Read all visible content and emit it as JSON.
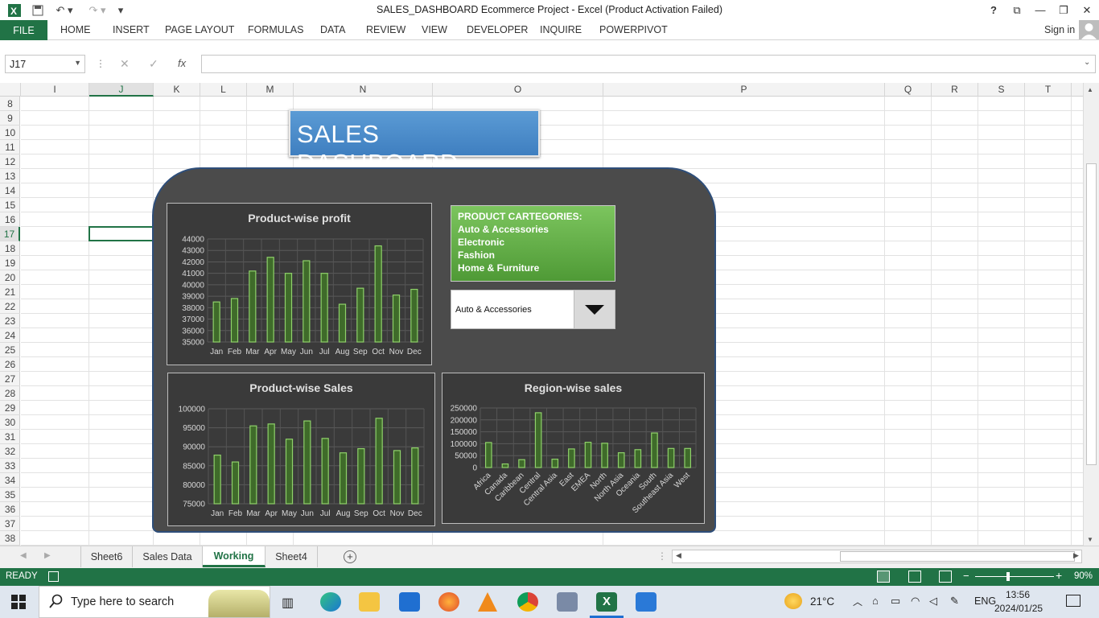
{
  "window": {
    "title": "SALES_DASHBOARD Ecommerce Project - Excel (Product Activation Failed)",
    "help": "?",
    "sign_in": "Sign in"
  },
  "ribbon": {
    "file": "FILE",
    "tabs": [
      "HOME",
      "INSERT",
      "PAGE LAYOUT",
      "FORMULAS",
      "DATA",
      "REVIEW",
      "VIEW",
      "DEVELOPER",
      "INQUIRE",
      "POWERPIVOT"
    ]
  },
  "formula_bar": {
    "name_box": "J17",
    "fx": "fx",
    "formula": ""
  },
  "grid": {
    "columns": [
      "I",
      "J",
      "K",
      "L",
      "M",
      "N",
      "O",
      "P",
      "Q",
      "R",
      "S",
      "T"
    ],
    "rows": [
      "8",
      "9",
      "10",
      "11",
      "12",
      "13",
      "14",
      "15",
      "16",
      "17",
      "18",
      "19",
      "20",
      "21",
      "22",
      "23",
      "24",
      "25",
      "26",
      "27",
      "28",
      "29",
      "30",
      "31",
      "32",
      "33",
      "34",
      "35",
      "36",
      "37",
      "38"
    ],
    "selected_cell": "J17"
  },
  "dashboard": {
    "banner": "SALES  DASHBOARD",
    "categories_title": "PRODUCT CARTEGORIES:",
    "categories": [
      "Auto & Accessories",
      "Electronic",
      "Fashion",
      "Home & Furniture"
    ],
    "dropdown_value": "Auto & Accessories",
    "accent_color": "#8fd16a"
  },
  "chart_data": [
    {
      "type": "bar",
      "title": "Product-wise profit",
      "categories": [
        "Jan",
        "Feb",
        "Mar",
        "Apr",
        "May",
        "Jun",
        "Jul",
        "Aug",
        "Sep",
        "Oct",
        "Nov",
        "Dec"
      ],
      "values": [
        38500,
        38800,
        41200,
        42400,
        41000,
        42100,
        41000,
        38300,
        39700,
        43400,
        39100,
        39600
      ],
      "yticks": [
        "44000",
        "43000",
        "42000",
        "41000",
        "40000",
        "39000",
        "38000",
        "37000",
        "36000",
        "35000"
      ],
      "ylim": [
        35000,
        44000
      ]
    },
    {
      "type": "bar",
      "title": "Product-wise Sales",
      "categories": [
        "Jan",
        "Feb",
        "Mar",
        "Apr",
        "May",
        "Jun",
        "Jul",
        "Aug",
        "Sep",
        "Oct",
        "Nov",
        "Dec"
      ],
      "values": [
        87800,
        86000,
        95500,
        96000,
        92000,
        96800,
        92200,
        88400,
        89500,
        97500,
        89000,
        89700
      ],
      "yticks": [
        "100000",
        "95000",
        "90000",
        "85000",
        "80000",
        "75000"
      ],
      "ylim": [
        75000,
        100000
      ]
    },
    {
      "type": "bar",
      "title": "Region-wise sales",
      "categories": [
        "Africa",
        "Canada",
        "Caribbean",
        "Central",
        "Central Asia",
        "East",
        "EMEA",
        "North",
        "North Asia",
        "Oceania",
        "South",
        "Southeast Asia",
        "West"
      ],
      "values": [
        105000,
        15000,
        33000,
        230000,
        35000,
        78000,
        106000,
        102000,
        62000,
        75000,
        145000,
        80000,
        80000
      ],
      "yticks": [
        "250000",
        "200000",
        "150000",
        "100000",
        "50000",
        "0"
      ],
      "ylim": [
        0,
        250000
      ]
    }
  ],
  "sheets": {
    "tabs": [
      "Sheet6",
      "Sales Data",
      "Working",
      "Sheet4"
    ],
    "active": "Working"
  },
  "status": {
    "ready": "READY",
    "zoom": "90%"
  },
  "taskbar": {
    "search_placeholder": "Type here to search",
    "weather": "21°C",
    "lang": "ENG",
    "time": "13:56",
    "date": "2024/01/25"
  }
}
